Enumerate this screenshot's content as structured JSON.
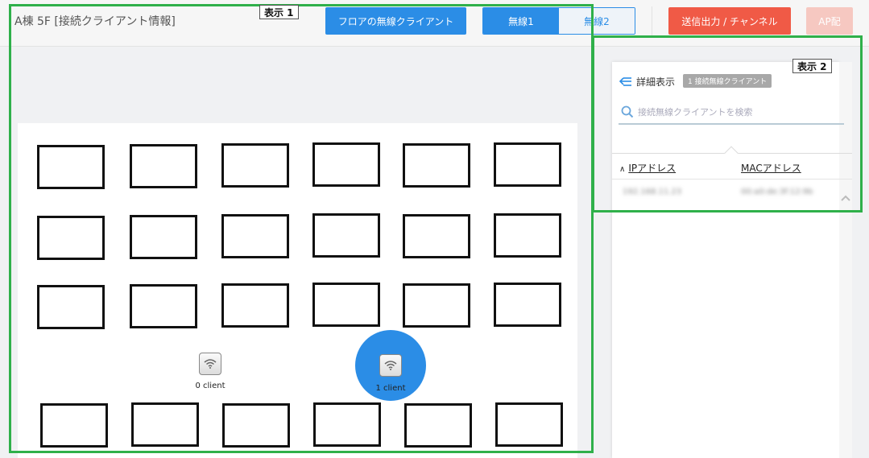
{
  "header": {
    "title": "A棟 5F [接続クライアント情報]",
    "floor_clients_button": "フロアの無線クライアント",
    "radio_tabs": [
      {
        "label": "無線1",
        "selected": true
      },
      {
        "label": "無線2",
        "selected": false
      }
    ],
    "export_button": "送信出力 / チャンネル",
    "ap_button": "AP配"
  },
  "floor_map": {
    "access_points": [
      {
        "label": "0 client",
        "active": false
      },
      {
        "label": "1 client",
        "active": true
      }
    ]
  },
  "panel": {
    "detail_label": "詳細表示",
    "client_count_badge": "1 接続無線クライアント",
    "search_placeholder": "接続無線クライアントを検索",
    "columns": {
      "ip": "IPアドレス",
      "mac": "MACアドレス"
    },
    "rows": [
      {
        "ip": "192.168.11.23",
        "mac": "00:a0:de:3f:12:9b"
      }
    ]
  },
  "callouts": {
    "display1": "表示 1",
    "display2": "表示 2"
  },
  "colors": {
    "primary": "#2b8de6",
    "danger": "#f05a46",
    "callout": "#2fb04a"
  }
}
